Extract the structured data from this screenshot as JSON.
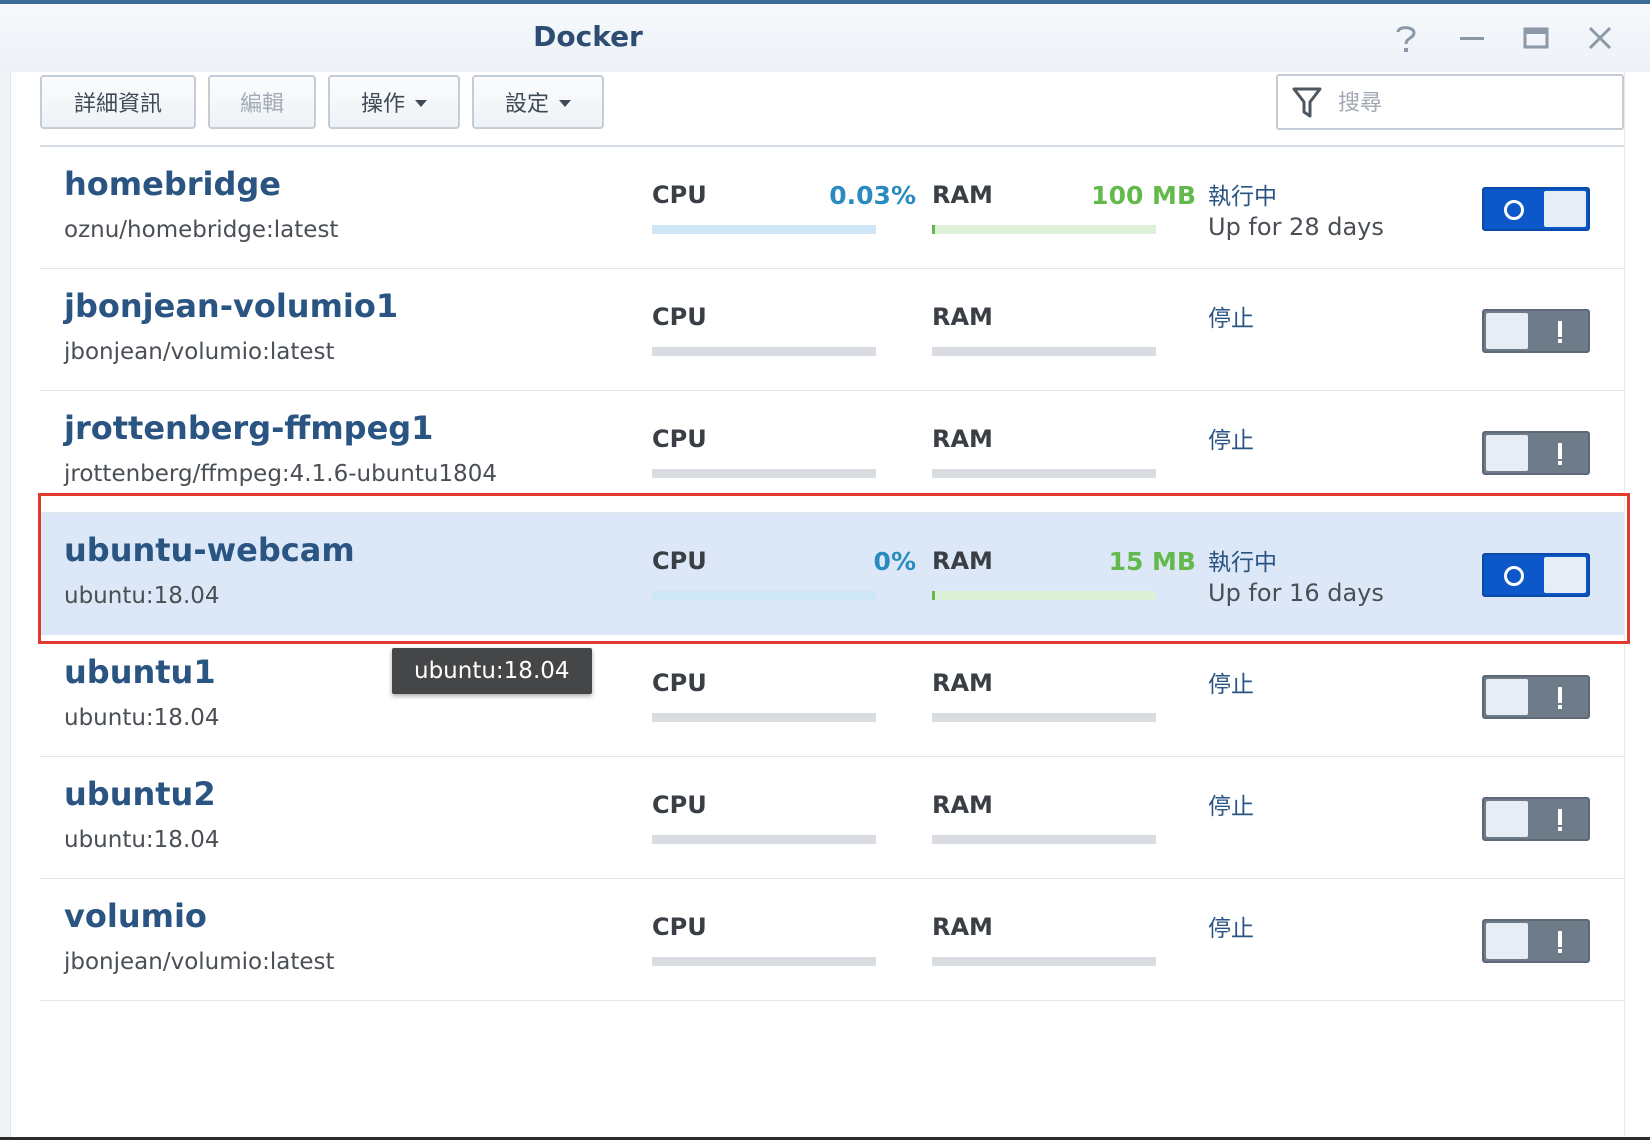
{
  "window": {
    "title": "Docker",
    "controls": [
      "help-icon",
      "minimize-icon",
      "maximize-icon",
      "close-icon"
    ]
  },
  "toolbar": {
    "details_label": "詳細資訊",
    "edit_label": "編輯",
    "action_label": "操作",
    "settings_label": "設定",
    "search_placeholder": "搜尋"
  },
  "colors": {
    "accent": "#2a5482",
    "cpu": "#2a8bc1",
    "ram": "#64b94c",
    "toggle_on": "#0d58c8",
    "toggle_off": "#6e7c89",
    "highlight": "#e03a2f",
    "selected_row": "#dce8f7"
  },
  "labels": {
    "cpu": "CPU",
    "ram": "RAM"
  },
  "containers": [
    {
      "name": "homebridge",
      "image": "oznu/homebridge:latest",
      "cpu": "0.03%",
      "ram": "100 MB",
      "status": "執行中",
      "uptime": "Up for 28 days",
      "running": true,
      "selected": false
    },
    {
      "name": "jbonjean-volumio1",
      "image": "jbonjean/volumio:latest",
      "cpu": "",
      "ram": "",
      "status": "停止",
      "uptime": "",
      "running": false,
      "selected": false
    },
    {
      "name": "jrottenberg-ffmpeg1",
      "image": "jrottenberg/ffmpeg:4.1.6-ubuntu1804",
      "cpu": "",
      "ram": "",
      "status": "停止",
      "uptime": "",
      "running": false,
      "selected": false
    },
    {
      "name": "ubuntu-webcam",
      "image": "ubuntu:18.04",
      "cpu": "0%",
      "ram": "15 MB",
      "status": "執行中",
      "uptime": "Up for 16 days",
      "running": true,
      "selected": true
    },
    {
      "name": "ubuntu1",
      "image": "ubuntu:18.04",
      "cpu": "",
      "ram": "",
      "status": "停止",
      "uptime": "",
      "running": false,
      "selected": false
    },
    {
      "name": "ubuntu2",
      "image": "ubuntu:18.04",
      "cpu": "",
      "ram": "",
      "status": "停止",
      "uptime": "",
      "running": false,
      "selected": false
    },
    {
      "name": "volumio",
      "image": "jbonjean/volumio:latest",
      "cpu": "",
      "ram": "",
      "status": "停止",
      "uptime": "",
      "running": false,
      "selected": false
    }
  ],
  "tooltip": {
    "text": "ubuntu:18.04"
  }
}
